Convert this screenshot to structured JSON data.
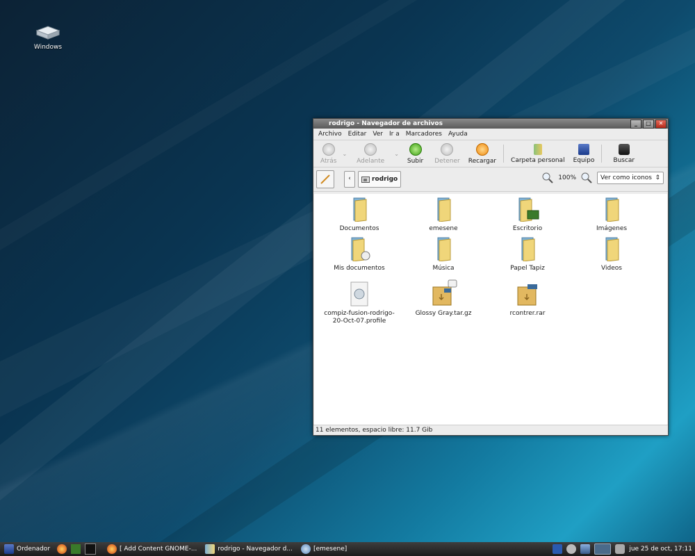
{
  "desktop": {
    "icon_label": "Windows"
  },
  "window": {
    "title": "rodrigo - Navegador de archivos",
    "min_label": "_",
    "max_label": "□",
    "close_label": "✕"
  },
  "menu": [
    "Archivo",
    "Editar",
    "Ver",
    "Ir a",
    "Marcadores",
    "Ayuda"
  ],
  "toolbar": {
    "back": "Atrás",
    "forward": "Adelante",
    "up": "Subir",
    "stop": "Detener",
    "reload": "Recargar",
    "home": "Carpeta personal",
    "computer": "Equipo",
    "search": "Buscar"
  },
  "location": {
    "crumb": "rodrigo",
    "back_glyph": "‹",
    "zoom": "100%",
    "view_mode": "Ver como iconos",
    "view_arrow": "⇕"
  },
  "files": [
    {
      "name": "Documentos",
      "kind": "folder"
    },
    {
      "name": "emesene",
      "kind": "folder"
    },
    {
      "name": "Escritorio",
      "kind": "folder-desktop"
    },
    {
      "name": "Imágenes",
      "kind": "folder"
    },
    {
      "name": "Mis documentos",
      "kind": "folder-link"
    },
    {
      "name": "Música",
      "kind": "folder"
    },
    {
      "name": "Papel Tapiz",
      "kind": "folder"
    },
    {
      "name": "Videos",
      "kind": "folder"
    },
    {
      "name": "compiz-fusion-rodrigo-20-Oct-07.profile",
      "kind": "doc"
    },
    {
      "name": "Glossy Gray.tar.gz",
      "kind": "archive-locked"
    },
    {
      "name": "rcontrer.rar",
      "kind": "archive"
    }
  ],
  "status": "11 elementos, espacio libre: 11.7 Gib",
  "taskbar": {
    "start": "Ordenador",
    "tasks": [
      "[ Add Content GNOME-...",
      "rodrigo - Navegador d...",
      "[emesene]"
    ],
    "clock": "jue 25 de oct, 17:11"
  }
}
